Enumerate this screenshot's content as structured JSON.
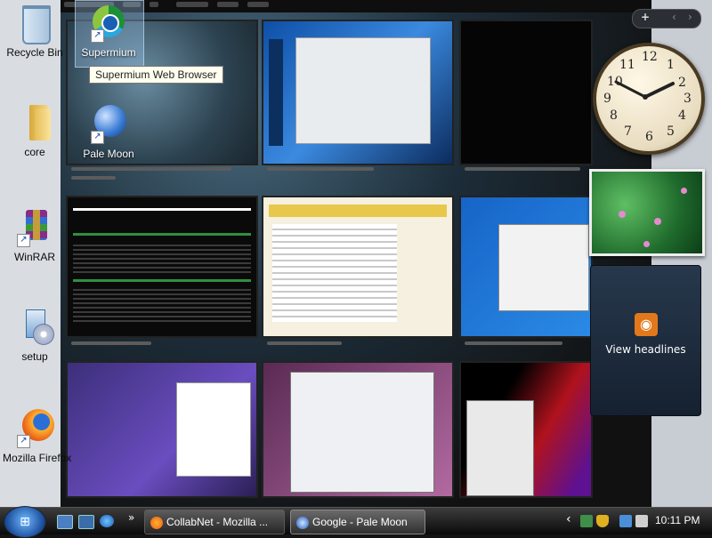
{
  "desktop_icons": [
    {
      "label": "Recycle Bin",
      "icon": "recycle-bin-icon"
    },
    {
      "label": "Supermium",
      "icon": "supermium-icon"
    },
    {
      "label": "core",
      "icon": "folder-icon"
    },
    {
      "label": "Pale Moon",
      "icon": "pale-moon-icon"
    },
    {
      "label": "WinRAR",
      "icon": "winrar-icon"
    },
    {
      "label": "setup",
      "icon": "setup-icon"
    },
    {
      "label": "Mozilla Firefox",
      "icon": "firefox-icon"
    }
  ],
  "tooltip": "Supermium Web Browser",
  "feed_gadget": {
    "label": "View headlines"
  },
  "gadget_controls": {
    "add": "+",
    "prev": "‹",
    "next": "›"
  },
  "taskbar": {
    "buttons": [
      {
        "label": "CollabNet - Mozilla ..."
      },
      {
        "label": "Google - Pale Moon"
      }
    ],
    "overflow": "»",
    "tray_arrow": "‹",
    "clock": "10:11 PM"
  },
  "clock_numbers": [
    "12",
    "1",
    "2",
    "3",
    "4",
    "5",
    "6",
    "7",
    "8",
    "9",
    "10",
    "11"
  ],
  "colors": {
    "taskbar": "#1a1a1a",
    "accent": "#1a4c9a",
    "rss": "#e2781b"
  }
}
